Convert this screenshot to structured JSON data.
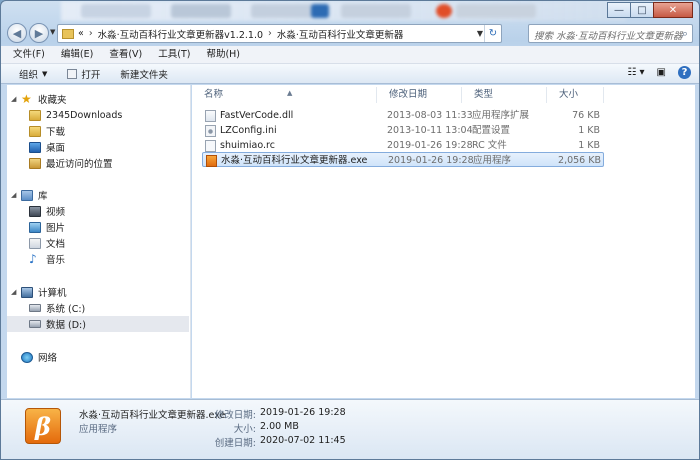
{
  "window": {
    "caption_buttons": [
      "—",
      "□",
      "✕"
    ]
  },
  "address": {
    "overflow": "«",
    "crumbs": [
      "水淼·互动百科行业文章更新器v1.2.1.0",
      "水淼·互动百科行业文章更新器"
    ],
    "search_placeholder": "搜索 水淼·互动百科行业文章更新器"
  },
  "menu": [
    "文件(F)",
    "编辑(E)",
    "查看(V)",
    "工具(T)",
    "帮助(H)"
  ],
  "toolbar": {
    "organize": "组织",
    "open": "打开",
    "new_folder": "新建文件夹"
  },
  "nav": {
    "favorites": "收藏夹",
    "fav_items": [
      "2345Downloads",
      "下载",
      "桌面",
      "最近访问的位置"
    ],
    "libraries": "库",
    "lib_items": [
      "视频",
      "图片",
      "文档",
      "音乐"
    ],
    "computer": "计算机",
    "drives": [
      "系统 (C:)",
      "数据 (D:)"
    ],
    "network": "网络"
  },
  "columns": {
    "name": "名称",
    "date": "修改日期",
    "type": "类型",
    "size": "大小"
  },
  "files": [
    {
      "name": "FastVerCode.dll",
      "date": "2013-08-03 11:33",
      "type": "应用程序扩展",
      "size": "76 KB"
    },
    {
      "name": "LZConfig.ini",
      "date": "2013-10-11 13:04",
      "type": "配置设置",
      "size": "1 KB"
    },
    {
      "name": "shuimiao.rc",
      "date": "2019-01-26 19:28",
      "type": "RC 文件",
      "size": "1 KB"
    },
    {
      "name": "水淼·互动百科行业文章更新器.exe",
      "date": "2019-01-26 19:28",
      "type": "应用程序",
      "size": "2,056 KB"
    }
  ],
  "details": {
    "filename": "水淼·互动百科行业文章更新器.exe",
    "filetype": "应用程序",
    "modified_label": "修改日期:",
    "modified_value": "2019-01-26 19:28",
    "size_label": "大小:",
    "size_value": "2.00 MB",
    "created_label": "创建日期:",
    "created_value": "2020-07-02 11:45",
    "icon_glyph": "β"
  }
}
